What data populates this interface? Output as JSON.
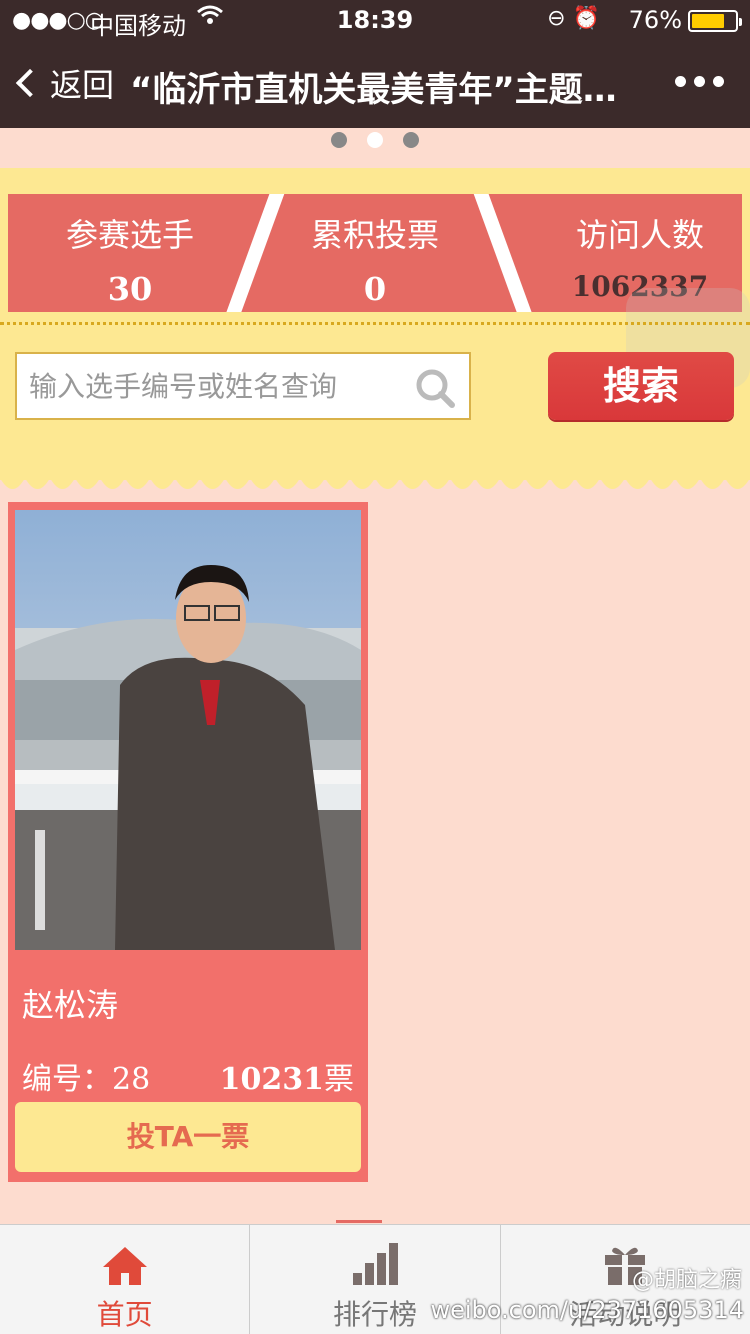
{
  "status_bar": {
    "signal": "●●●○○",
    "carrier": "中国移动",
    "time": "18:39",
    "battery_percent": "76%",
    "battery_level": 0.76
  },
  "nav": {
    "back_label": "返回",
    "title": "“临沂市直机关最美青年”主题…"
  },
  "carousel": {
    "count": 3,
    "active_index": 1
  },
  "stats": {
    "players_label": "参赛选手",
    "players_value": "30",
    "votes_label": "累积投票",
    "votes_value": "0",
    "visitors_label": "访问人数",
    "visitors_value": "1062337"
  },
  "search": {
    "placeholder": "输入选手编号或姓名查询",
    "button_label": "搜索"
  },
  "candidate": {
    "name": "赵松涛",
    "number_label": "编号：",
    "number": "28",
    "votes": "10231",
    "votes_unit": "票",
    "vote_button_label": "投TA一票"
  },
  "tabs": [
    {
      "label": "首页",
      "icon": "home-icon",
      "active": true
    },
    {
      "label": "排行榜",
      "icon": "bar-chart-icon",
      "active": false
    },
    {
      "label": "活动说明",
      "icon": "gift-icon",
      "active": false
    }
  ],
  "watermark": {
    "handle": "@胡脑之瘸",
    "url": "weibo.com/u/2371605314"
  },
  "colors": {
    "accent": "#e56a63",
    "yellow": "#fde892",
    "background": "#fddccf",
    "button_red": "#d9383a"
  }
}
